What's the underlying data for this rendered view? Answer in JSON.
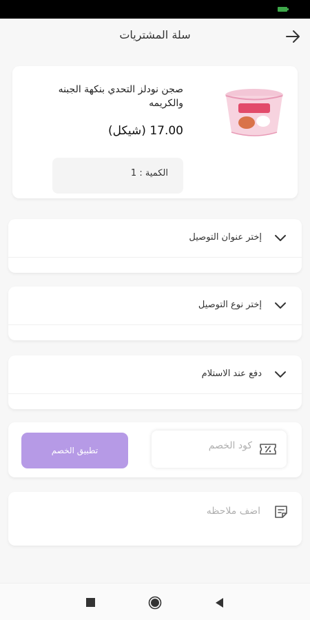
{
  "header": {
    "title": "سلة المشتريات"
  },
  "cart": {
    "item": {
      "name": "صجن نودلز التحدي بنكهة الجبنه والكريمه",
      "price": "17.00 (شيكل)",
      "quantity": "الكمية : 1"
    }
  },
  "checkout": {
    "address_select": {
      "label": "إختر عنوان التوصيل"
    },
    "delivery_select": {
      "label": "إختر نوع التوصيل"
    },
    "payment_select": {
      "label": "دفع عند الاستلام"
    }
  },
  "coupon": {
    "placeholder": "كود الخصم",
    "apply_label": "تطبيق الخصم"
  },
  "note": {
    "placeholder": "اضف ملاحظه"
  },
  "colors": {
    "accent": "#b69ae6",
    "background": "#f7f7f7",
    "battery": "#3ea84a"
  },
  "icons": {
    "back": "arrow-right-icon",
    "dropdown": "chevron-down-icon",
    "coupon": "discount-ticket-icon",
    "note": "note-icon"
  }
}
